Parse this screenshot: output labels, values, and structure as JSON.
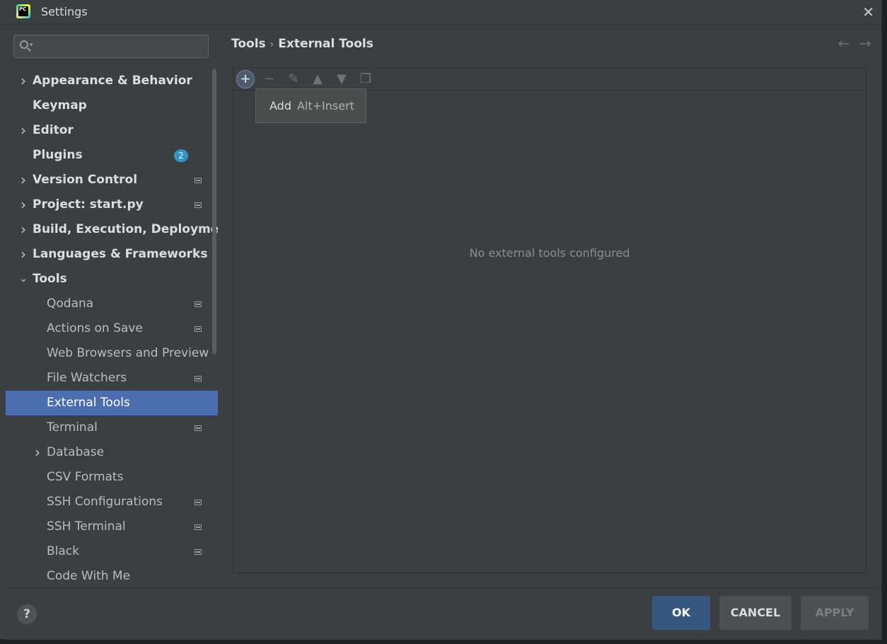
{
  "window": {
    "title": "Settings"
  },
  "search": {
    "value": "",
    "placeholder": ""
  },
  "sidebar": {
    "items": [
      {
        "label": "Appearance & Behavior",
        "bold": true,
        "arrow": "right",
        "indent": 0,
        "badge": "",
        "project": false,
        "selected": false
      },
      {
        "label": "Keymap",
        "bold": true,
        "arrow": "",
        "indent": 0,
        "badge": "",
        "project": false,
        "selected": false
      },
      {
        "label": "Editor",
        "bold": true,
        "arrow": "right",
        "indent": 0,
        "badge": "",
        "project": false,
        "selected": false
      },
      {
        "label": "Plugins",
        "bold": true,
        "arrow": "",
        "indent": 0,
        "badge": "2",
        "project": false,
        "selected": false
      },
      {
        "label": "Version Control",
        "bold": true,
        "arrow": "right",
        "indent": 0,
        "badge": "",
        "project": true,
        "selected": false
      },
      {
        "label": "Project: start.py",
        "bold": true,
        "arrow": "right",
        "indent": 0,
        "badge": "",
        "project": true,
        "selected": false
      },
      {
        "label": "Build, Execution, Deployment",
        "bold": true,
        "arrow": "right",
        "indent": 0,
        "badge": "",
        "project": false,
        "selected": false
      },
      {
        "label": "Languages & Frameworks",
        "bold": true,
        "arrow": "right",
        "indent": 0,
        "badge": "",
        "project": false,
        "selected": false
      },
      {
        "label": "Tools",
        "bold": true,
        "arrow": "down",
        "indent": 0,
        "badge": "",
        "project": false,
        "selected": false
      },
      {
        "label": "Qodana",
        "bold": false,
        "arrow": "",
        "indent": 1,
        "badge": "",
        "project": true,
        "selected": false
      },
      {
        "label": "Actions on Save",
        "bold": false,
        "arrow": "",
        "indent": 1,
        "badge": "",
        "project": true,
        "selected": false
      },
      {
        "label": "Web Browsers and Preview",
        "bold": false,
        "arrow": "",
        "indent": 1,
        "badge": "",
        "project": false,
        "selected": false
      },
      {
        "label": "File Watchers",
        "bold": false,
        "arrow": "",
        "indent": 1,
        "badge": "",
        "project": true,
        "selected": false
      },
      {
        "label": "External Tools",
        "bold": false,
        "arrow": "",
        "indent": 1,
        "badge": "",
        "project": false,
        "selected": true
      },
      {
        "label": "Terminal",
        "bold": false,
        "arrow": "",
        "indent": 1,
        "badge": "",
        "project": true,
        "selected": false
      },
      {
        "label": "Database",
        "bold": false,
        "arrow": "right",
        "indent": 1,
        "badge": "",
        "project": false,
        "selected": false
      },
      {
        "label": "CSV Formats",
        "bold": false,
        "arrow": "",
        "indent": 1,
        "badge": "",
        "project": false,
        "selected": false
      },
      {
        "label": "SSH Configurations",
        "bold": false,
        "arrow": "",
        "indent": 1,
        "badge": "",
        "project": true,
        "selected": false
      },
      {
        "label": "SSH Terminal",
        "bold": false,
        "arrow": "",
        "indent": 1,
        "badge": "",
        "project": true,
        "selected": false
      },
      {
        "label": "Black",
        "bold": false,
        "arrow": "",
        "indent": 1,
        "badge": "",
        "project": true,
        "selected": false
      },
      {
        "label": "Code With Me",
        "bold": false,
        "arrow": "",
        "indent": 1,
        "badge": "",
        "project": false,
        "selected": false
      }
    ]
  },
  "breadcrumb": {
    "parent": "Tools",
    "separator": "›",
    "current": "External Tools"
  },
  "toolbar": {
    "buttons": [
      {
        "name": "add",
        "icon": "plus-icon",
        "glyph": "+",
        "active": true
      },
      {
        "name": "remove",
        "icon": "minus-icon",
        "glyph": "−",
        "active": false
      },
      {
        "name": "edit",
        "icon": "pencil-icon",
        "glyph": "✎",
        "active": false
      },
      {
        "name": "move-up",
        "icon": "triangle-up-icon",
        "glyph": "▲",
        "active": false
      },
      {
        "name": "move-down",
        "icon": "triangle-down-icon",
        "glyph": "▼",
        "active": false
      },
      {
        "name": "copy",
        "icon": "copy-icon",
        "glyph": "❐",
        "active": false
      }
    ]
  },
  "tooltip": {
    "label": "Add",
    "shortcut": "Alt+Insert"
  },
  "content": {
    "empty_text": "No external tools configured"
  },
  "footer": {
    "help": "?",
    "ok": "OK",
    "cancel": "CANCEL",
    "apply": "APPLY"
  },
  "colors": {
    "selection": "#4b6eaf",
    "badge": "#3592c4",
    "ok_button": "#365880"
  }
}
